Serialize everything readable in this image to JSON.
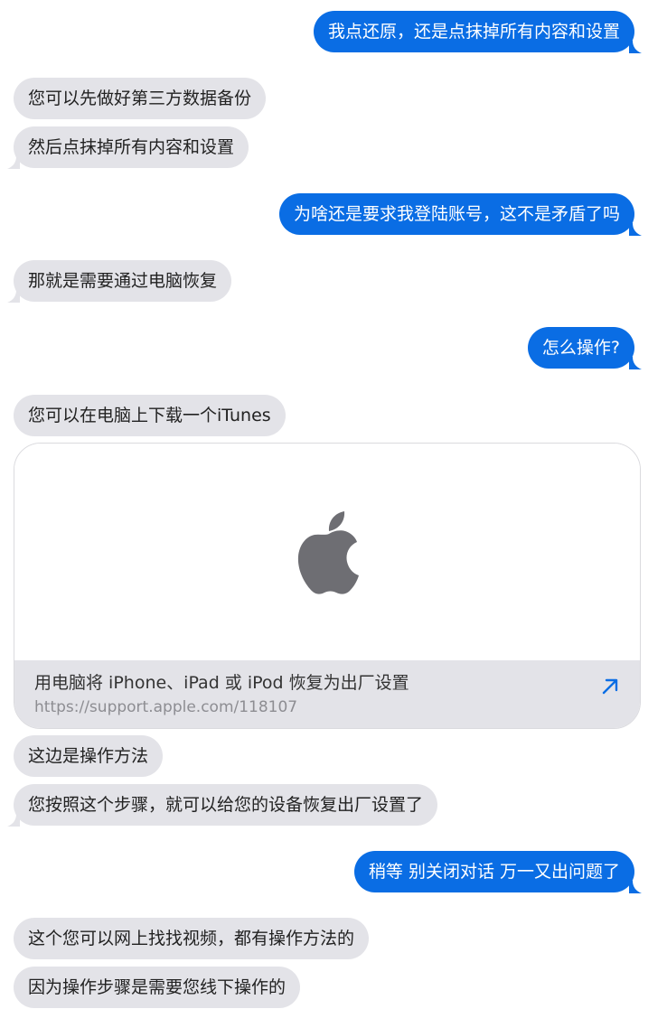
{
  "colors": {
    "outgoing": "#0a6de4",
    "incoming": "#e3e3e8"
  },
  "messages": [
    {
      "dir": "out",
      "text": "我点还原，还是点抹掉所有内容和设置"
    },
    {
      "dir": "in",
      "text": "您可以先做好第三方数据备份"
    },
    {
      "dir": "in",
      "text": "然后点抹掉所有内容和设置"
    },
    {
      "dir": "out",
      "text": "为啥还是要求我登陆账号，这不是矛盾了吗"
    },
    {
      "dir": "in",
      "text": "那就是需要通过电脑恢复"
    },
    {
      "dir": "out",
      "text": "怎么操作?"
    },
    {
      "dir": "in",
      "text": "您可以在电脑上下载一个iTunes"
    },
    {
      "dir": "in",
      "text": "这边是操作方法"
    },
    {
      "dir": "in",
      "text": "您按照这个步骤，就可以给您的设备恢复出厂设置了"
    },
    {
      "dir": "out",
      "text": "稍等 别关闭对话 万一又出问题了"
    },
    {
      "dir": "in",
      "text": "这个您可以网上找找视频，都有操作方法的"
    },
    {
      "dir": "in",
      "text": "因为操作步骤是需要您线下操作的"
    }
  ],
  "link_card": {
    "icon": "apple-logo-icon",
    "title": "用电脑将 iPhone、iPad 或 iPod 恢复为出厂设置",
    "url": "https://support.apple.com/118107",
    "action_icon": "open-link-arrow-icon"
  }
}
